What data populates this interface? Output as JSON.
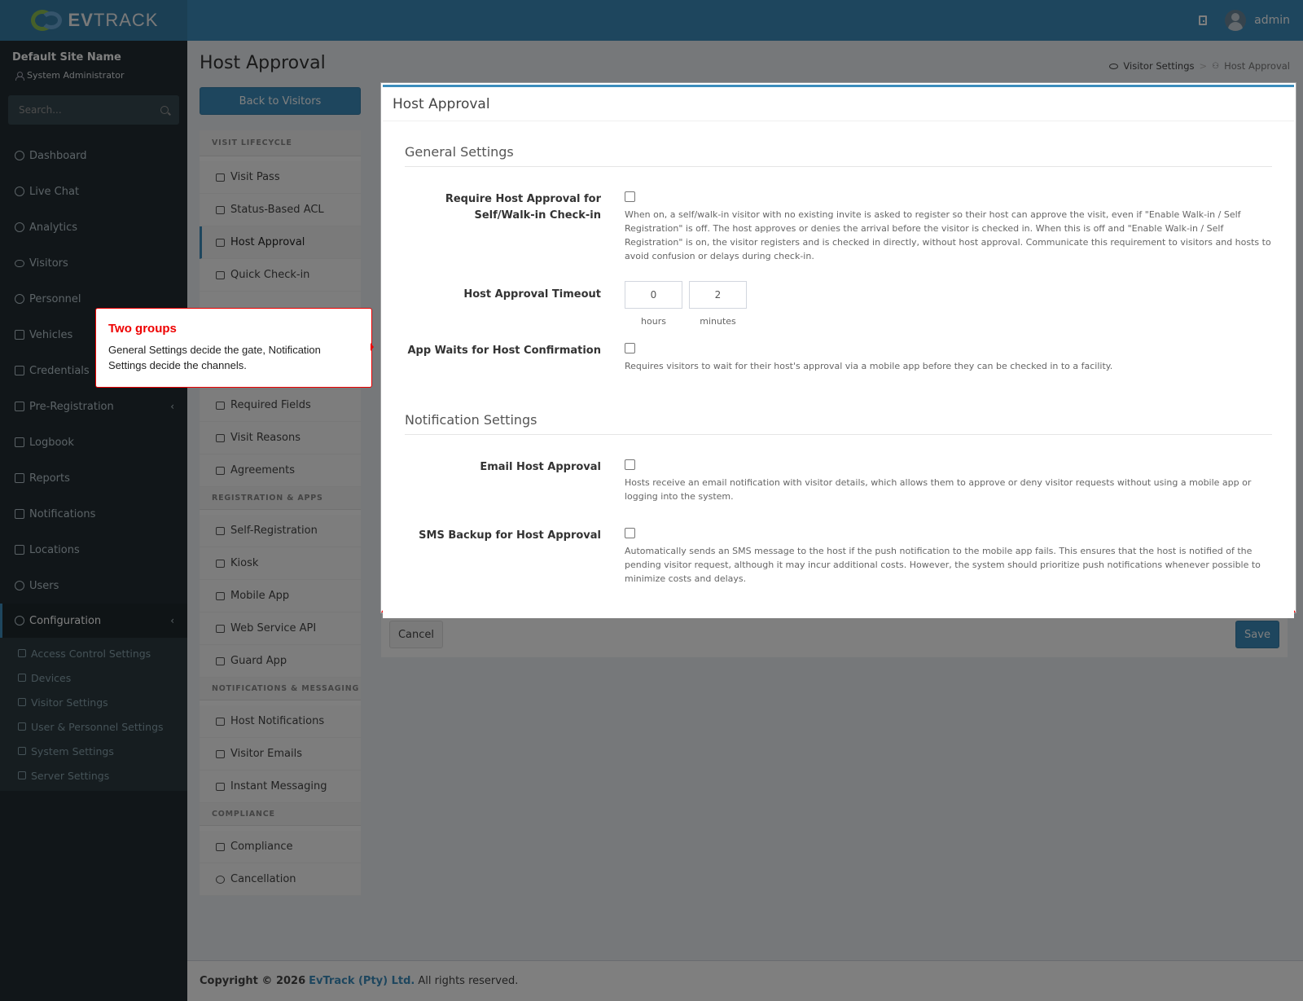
{
  "header": {
    "brand_ev": "EV",
    "brand_track": "TRACK",
    "username": "admin",
    "icons": [
      "door-icon",
      "avatar"
    ]
  },
  "sidebar": {
    "site_name": "Default Site Name",
    "role": "System Administrator",
    "search_placeholder": "Search...",
    "items": [
      {
        "label": "Dashboard",
        "icon": "dashboard-icon"
      },
      {
        "label": "Live Chat",
        "icon": "headset-icon"
      },
      {
        "label": "Analytics",
        "icon": "target-icon"
      },
      {
        "label": "Visitors",
        "icon": "eye-icon"
      },
      {
        "label": "Personnel",
        "icon": "user-cog-icon"
      },
      {
        "label": "Vehicles",
        "icon": "car-icon"
      },
      {
        "label": "Credentials",
        "icon": "badge-icon"
      },
      {
        "label": "Pre-Registration",
        "icon": "arrows-icon"
      },
      {
        "label": "Logbook",
        "icon": "book-icon"
      },
      {
        "label": "Reports",
        "icon": "chart-icon"
      },
      {
        "label": "Notifications",
        "icon": "bell-icon"
      },
      {
        "label": "Locations",
        "icon": "map-icon"
      },
      {
        "label": "Users",
        "icon": "users-icon"
      },
      {
        "label": "Configuration",
        "icon": "gear-icon"
      }
    ],
    "sub_items": [
      {
        "label": "Access Control Settings",
        "icon": "lock-icon"
      },
      {
        "label": "Devices",
        "icon": "cog-icon"
      },
      {
        "label": "Visitor Settings",
        "icon": "eye-icon"
      },
      {
        "label": "User & Personnel Settings",
        "icon": "user-icon"
      },
      {
        "label": "System Settings",
        "icon": "sliders-icon"
      },
      {
        "label": "Server Settings",
        "icon": "server-icon"
      }
    ]
  },
  "page": {
    "title": "Host Approval",
    "breadcrumb": [
      "Visitor Settings",
      "Host Approval"
    ],
    "back_button": "Back to Visitors"
  },
  "settings_nav": {
    "sections": [
      {
        "title": "VISIT LIFECYCLE",
        "items": [
          "Visit Pass",
          "Status-Based ACL",
          "Host Approval",
          "Quick Check-in"
        ]
      },
      {
        "title": "",
        "items": [
          "Required Fields",
          "Visit Reasons",
          "Agreements"
        ]
      },
      {
        "title": "REGISTRATION & APPS",
        "items": [
          "Self-Registration",
          "Kiosk",
          "Mobile App",
          "Web Service API",
          "Guard App"
        ]
      },
      {
        "title": "NOTIFICATIONS & MESSAGING",
        "items": [
          "Host Notifications",
          "Visitor Emails",
          "Instant Messaging"
        ]
      },
      {
        "title": "COMPLIANCE",
        "items": [
          "Compliance",
          "Cancellation"
        ]
      }
    ],
    "active": "Host Approval"
  },
  "panel": {
    "title": "Host Approval",
    "general_title": "General Settings",
    "notification_title": "Notification Settings",
    "require_label": "Require Host Approval for Self/Walk-in Check-in",
    "require_checked": false,
    "require_help": "When on, a self/walk-in visitor with no existing invite is asked to register so their host can approve the visit, even if \"Enable Walk-in / Self Registration\" is off. The host approves or denies the arrival before the visitor is checked in. When this is off and \"Enable Walk-in / Self Registration\" is on, the visitor registers and is checked in directly, without host approval. Communicate this requirement to visitors and hosts to avoid confusion or delays during check-in.",
    "timeout_label": "Host Approval Timeout",
    "timeout_hours": "0",
    "timeout_minutes": "2",
    "hours_caption": "hours",
    "minutes_caption": "minutes",
    "app_waits_label": "App Waits for Host Confirmation",
    "app_waits_checked": false,
    "app_waits_help": "Requires visitors to wait for their host's approval via a mobile app before they can be checked in to a facility.",
    "email_label": "Email Host Approval",
    "email_checked": false,
    "email_help": "Hosts receive an email notification with visitor details, which allows them to approve or deny visitor requests without using a mobile app or logging into the system.",
    "sms_label": "SMS Backup for Host Approval",
    "sms_checked": false,
    "sms_help": "Automatically sends an SMS message to the host if the push notification to the mobile app fails. This ensures that the host is notified of the pending visitor request, although it may incur additional costs. However, the system should prioritize push notifications whenever possible to minimize costs and delays."
  },
  "actions": {
    "cancel": "Cancel",
    "save": "Save"
  },
  "footer": {
    "copyright": "Copyright © 2026",
    "company": "EvTrack (Pty) Ltd.",
    "rights": "All rights reserved."
  },
  "callout": {
    "title": "Two groups",
    "body": "General Settings decide the gate, Notification Settings decide the channels."
  },
  "colors": {
    "primary": "#3c8dbc",
    "sidebar": "#222d32",
    "callout_accent": "#e00000"
  }
}
